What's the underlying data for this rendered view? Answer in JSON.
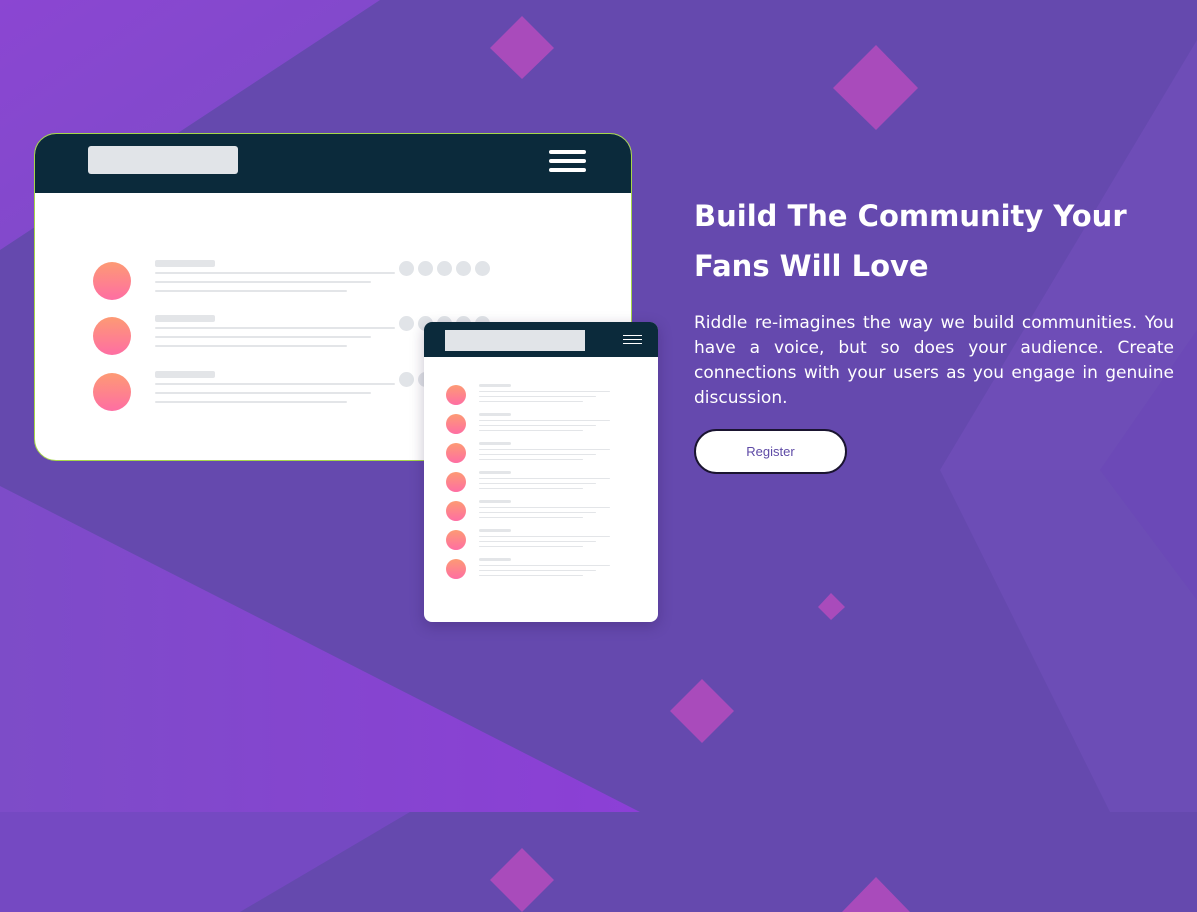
{
  "hero": {
    "title": "Build The Community Your Fans Will Love",
    "description": "Riddle re-imagines the way we build communities. You have a voice, but so does your audience. Create connections with your users as you engage in genuine discussion.",
    "register_label": "Register"
  },
  "colors": {
    "background": "#6549ae",
    "accent_purple": "#8a42d1",
    "diamond": "#b54bbd",
    "navbar": "#0b2a3b",
    "avatar_gradient_top": "#fd9a74",
    "avatar_gradient_bottom": "#fe6ea3",
    "button_text": "#5e4aa6"
  },
  "illustration": {
    "desktop_rows": 3,
    "mobile_rows": 7
  }
}
